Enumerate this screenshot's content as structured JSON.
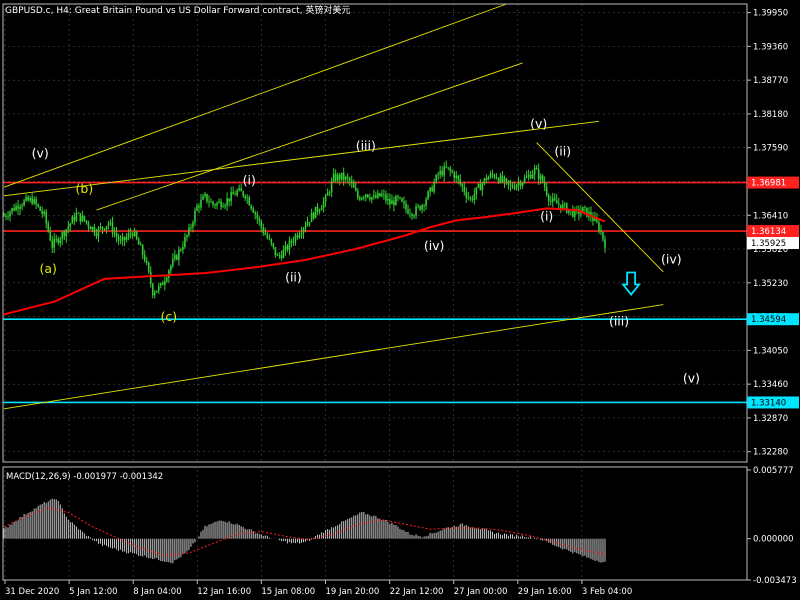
{
  "header": {
    "symbol_info": "GBPUSD.c, H4:  Great Britain Pound vs US Dollar Forward contract, 英镑对美元"
  },
  "colors": {
    "background": "#000000",
    "grid": "#4a4a4a",
    "candle": "#33cc33",
    "ma": "#ff0000",
    "trendline": "#e6e600",
    "support": "#00e5ff",
    "resistance": "#ff2020",
    "macd_hist": "#c8c8c8",
    "macd_signal": "#ff2020",
    "wave_white": "#ffffff",
    "wave_yellow": "#e6e600",
    "arrow": "#00e5ff"
  },
  "chart_data": [
    {
      "type": "candlestick",
      "title": "GBPUSD.c, H4:  Great Britain Pound vs US Dollar Forward contract, 英镑对美元",
      "ylim": [
        1.321,
        1.401
      ],
      "y_ticks": [
        "1.39950",
        "1.39360",
        "1.38770",
        "1.38180",
        "1.37590",
        "1.37000",
        "1.36410",
        "1.35820",
        "1.35230",
        "1.34640",
        "1.34050",
        "1.33460",
        "1.32870",
        "1.32280"
      ],
      "x_ticks": [
        "31 Dec 2020",
        "5 Jan 12:00",
        "8 Jan 04:00",
        "12 Jan 16:00",
        "15 Jan 08:00",
        "19 Jan 20:00",
        "22 Jan 12:00",
        "27 Jan 00:00",
        "29 Jan 16:00",
        "3 Feb 04:00"
      ],
      "close_path": [
        [
          0,
          1.364
        ],
        [
          8,
          1.3662
        ],
        [
          14,
          1.3668
        ],
        [
          20,
          1.364
        ],
        [
          24,
          1.3588
        ],
        [
          30,
          1.3612
        ],
        [
          36,
          1.3642
        ],
        [
          40,
          1.3632
        ],
        [
          46,
          1.3612
        ],
        [
          52,
          1.3628
        ],
        [
          58,
          1.3592
        ],
        [
          64,
          1.3612
        ],
        [
          70,
          1.3566
        ],
        [
          74,
          1.3508
        ],
        [
          78,
          1.3516
        ],
        [
          82,
          1.3547
        ],
        [
          86,
          1.357
        ],
        [
          92,
          1.3612
        ],
        [
          96,
          1.3656
        ],
        [
          100,
          1.3672
        ],
        [
          104,
          1.366
        ],
        [
          110,
          1.3665
        ],
        [
          116,
          1.3682
        ],
        [
          120,
          1.3678
        ],
        [
          124,
          1.3652
        ],
        [
          128,
          1.362
        ],
        [
          132,
          1.3595
        ],
        [
          136,
          1.3568
        ],
        [
          140,
          1.358
        ],
        [
          144,
          1.36
        ],
        [
          148,
          1.3618
        ],
        [
          152,
          1.3635
        ],
        [
          156,
          1.3652
        ],
        [
          160,
          1.3668
        ],
        [
          164,
          1.3706
        ],
        [
          168,
          1.3708
        ],
        [
          172,
          1.37
        ],
        [
          176,
          1.3672
        ],
        [
          180,
          1.368
        ],
        [
          184,
          1.367
        ],
        [
          188,
          1.3676
        ],
        [
          192,
          1.3662
        ],
        [
          196,
          1.3668
        ],
        [
          200,
          1.3652
        ],
        [
          204,
          1.3646
        ],
        [
          208,
          1.366
        ],
        [
          212,
          1.3682
        ],
        [
          216,
          1.3712
        ],
        [
          220,
          1.3722
        ],
        [
          224,
          1.3712
        ],
        [
          228,
          1.369
        ],
        [
          232,
          1.3668
        ],
        [
          236,
          1.3688
        ],
        [
          240,
          1.3706
        ],
        [
          244,
          1.3712
        ],
        [
          248,
          1.37
        ],
        [
          252,
          1.369
        ],
        [
          256,
          1.3698
        ],
        [
          260,
          1.3706
        ],
        [
          264,
          1.372
        ],
        [
          268,
          1.37
        ],
        [
          272,
          1.3665
        ],
        [
          276,
          1.366
        ],
        [
          280,
          1.3652
        ],
        [
          284,
          1.3644
        ],
        [
          288,
          1.365
        ],
        [
          292,
          1.364
        ],
        [
          296,
          1.362
        ],
        [
          299,
          1.3592
        ]
      ],
      "moving_average": [
        [
          0,
          1.3468
        ],
        [
          25,
          1.349
        ],
        [
          50,
          1.353
        ],
        [
          75,
          1.3535
        ],
        [
          100,
          1.354
        ],
        [
          125,
          1.355
        ],
        [
          150,
          1.3563
        ],
        [
          175,
          1.3582
        ],
        [
          200,
          1.3606
        ],
        [
          212,
          1.362
        ],
        [
          225,
          1.3632
        ],
        [
          240,
          1.3638
        ],
        [
          255,
          1.3645
        ],
        [
          270,
          1.3653
        ],
        [
          285,
          1.365
        ],
        [
          299,
          1.363
        ]
      ],
      "horizontal_levels": [
        {
          "kind": "resistance",
          "value": 1.36981,
          "label": "1.36981"
        },
        {
          "kind": "resistance",
          "value": 1.36134,
          "label": "1.36134"
        },
        {
          "kind": "support",
          "value": 1.34594,
          "label": "1.34594"
        },
        {
          "kind": "support",
          "value": 1.3314,
          "label": "1.33140"
        }
      ],
      "current_price": {
        "value": 1.35925,
        "label": "1.35925"
      },
      "trendlines": [
        [
          [
            0,
            1.369
          ],
          [
            250,
            1.401
          ]
        ],
        [
          [
            46,
            1.365
          ],
          [
            258,
            1.3907
          ]
        ],
        [
          [
            0,
            1.3675
          ],
          [
            296,
            1.3805
          ]
        ],
        [
          [
            0,
            1.3303
          ],
          [
            328,
            1.3485
          ]
        ],
        [
          [
            265,
            1.3768
          ],
          [
            328,
            1.3542
          ]
        ]
      ],
      "wave_labels": [
        {
          "text": "(v)",
          "x": 18,
          "y": 1.3742,
          "color": "white"
        },
        {
          "text": "(b)",
          "x": 40,
          "y": 1.368,
          "color": "yellow"
        },
        {
          "text": "(a)",
          "x": 22,
          "y": 1.354,
          "color": "yellow"
        },
        {
          "text": "(c)",
          "x": 82,
          "y": 1.3456,
          "color": "yellow"
        },
        {
          "text": "(i)",
          "x": 122,
          "y": 1.3695,
          "color": "white"
        },
        {
          "text": "(ii)",
          "x": 144,
          "y": 1.3525,
          "color": "white"
        },
        {
          "text": "(iii)",
          "x": 180,
          "y": 1.3755,
          "color": "white"
        },
        {
          "text": "(iv)",
          "x": 214,
          "y": 1.358,
          "color": "white"
        },
        {
          "text": "(v)",
          "x": 266,
          "y": 1.3793,
          "color": "white"
        },
        {
          "text": "(ii)",
          "x": 278,
          "y": 1.3745,
          "color": "white"
        },
        {
          "text": "(i)",
          "x": 270,
          "y": 1.3632,
          "color": "white"
        },
        {
          "text": "(iv)",
          "x": 332,
          "y": 1.3557,
          "color": "white"
        },
        {
          "text": "(iii)",
          "x": 306,
          "y": 1.3448,
          "color": "white"
        },
        {
          "text": "(v)",
          "x": 342,
          "y": 1.3349,
          "color": "white"
        }
      ],
      "arrow": {
        "direction": "down",
        "x": 312,
        "y": 1.352
      }
    },
    {
      "type": "bar",
      "name": "MACD",
      "label": "MACD(12,26,9) -0.001977 -0.001342",
      "ylim": [
        -0.003473,
        0.005777
      ],
      "y_ticks": [
        "0.005777",
        "0.000000",
        "-0.003473"
      ],
      "histogram": [
        [
          0,
          0.0008
        ],
        [
          10,
          0.002
        ],
        [
          20,
          0.003
        ],
        [
          26,
          0.0034
        ],
        [
          32,
          0.0016
        ],
        [
          40,
          0.0004
        ],
        [
          48,
          -0.0005
        ],
        [
          58,
          -0.001
        ],
        [
          68,
          -0.0014
        ],
        [
          78,
          -0.0018
        ],
        [
          84,
          -0.002
        ],
        [
          92,
          -0.001
        ],
        [
          100,
          0.001
        ],
        [
          108,
          0.0016
        ],
        [
          116,
          0.0012
        ],
        [
          124,
          0.0006
        ],
        [
          132,
          0.0001
        ],
        [
          138,
          -0.0002
        ],
        [
          144,
          -0.0004
        ],
        [
          150,
          -0.0003
        ],
        [
          158,
          0.0005
        ],
        [
          166,
          0.0012
        ],
        [
          172,
          0.0017
        ],
        [
          178,
          0.0022
        ],
        [
          186,
          0.0018
        ],
        [
          194,
          0.0012
        ],
        [
          202,
          0.0004
        ],
        [
          208,
          0.0002
        ],
        [
          214,
          0.0005
        ],
        [
          220,
          0.0009
        ],
        [
          228,
          0.0012
        ],
        [
          236,
          0.0009
        ],
        [
          244,
          0.0005
        ],
        [
          252,
          0.0003
        ],
        [
          260,
          0.0002
        ],
        [
          268,
          -0.0001
        ],
        [
          276,
          -0.0007
        ],
        [
          284,
          -0.0012
        ],
        [
          292,
          -0.0017
        ],
        [
          299,
          -0.002
        ]
      ],
      "signal": [
        [
          0,
          0.001
        ],
        [
          10,
          0.0018
        ],
        [
          22,
          0.0026
        ],
        [
          32,
          0.0022
        ],
        [
          44,
          0.001
        ],
        [
          56,
          0.0001
        ],
        [
          68,
          -0.0008
        ],
        [
          80,
          -0.0014
        ],
        [
          92,
          -0.0012
        ],
        [
          104,
          -0.0004
        ],
        [
          116,
          0.0004
        ],
        [
          128,
          0.0006
        ],
        [
          140,
          0.0002
        ],
        [
          152,
          -0.0001
        ],
        [
          164,
          0.0004
        ],
        [
          176,
          0.0012
        ],
        [
          188,
          0.0016
        ],
        [
          200,
          0.0012
        ],
        [
          212,
          0.0008
        ],
        [
          224,
          0.0009
        ],
        [
          236,
          0.0009
        ],
        [
          248,
          0.0007
        ],
        [
          260,
          0.0003
        ],
        [
          272,
          -0.0002
        ],
        [
          284,
          -0.0008
        ],
        [
          299,
          -0.0013
        ]
      ]
    }
  ]
}
